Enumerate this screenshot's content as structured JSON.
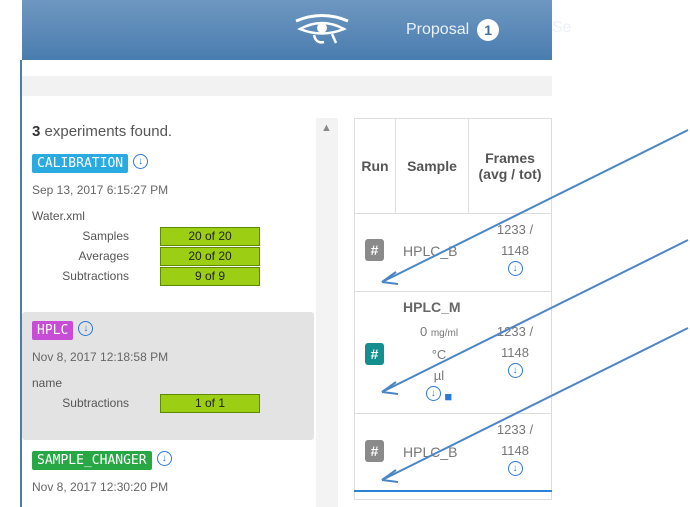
{
  "header": {
    "proposal_label": "Proposal",
    "proposal_count": "1",
    "next_tab_label": "Se"
  },
  "experiments": {
    "count": "3",
    "count_suffix": "experiments found.",
    "items": [
      {
        "tag": "CALIBRATION",
        "tag_color": "#29abe2",
        "date": "Sep 13, 2017 6:15:27 PM",
        "name": "Water.xml",
        "stats": [
          {
            "label": "Samples",
            "value": "20 of 20"
          },
          {
            "label": "Averages",
            "value": "20 of 20"
          },
          {
            "label": "Subtractions",
            "value": "9 of 9"
          }
        ]
      },
      {
        "tag": "HPLC",
        "tag_color": "#c74cd6",
        "date": "Nov 8, 2017 12:18:58 PM",
        "name": "name",
        "stats": [
          {
            "label": "Subtractions",
            "value": "1 of 1"
          }
        ]
      },
      {
        "tag": "SAMPLE_CHANGER",
        "tag_color": "#28a745",
        "date": "Nov 8, 2017 12:30:20 PM"
      }
    ]
  },
  "table": {
    "columns": [
      "Run",
      "Sample",
      "Frames",
      "(avg / tot)"
    ],
    "rows": [
      {
        "run": "#",
        "run_color": "#8a8a8a",
        "sample": "HPLC_B",
        "frames_avg": "1233 /",
        "frames_tot": "1148"
      },
      {
        "run": "#",
        "run_color": "#138f8f",
        "sample": "HPLC_M",
        "conc_value": "0",
        "conc_unit": "mg/ml",
        "temp_unit": "°C",
        "vol_unit": "µl",
        "frames_avg": "1233 /",
        "frames_tot": "1148"
      },
      {
        "run": "#",
        "run_color": "#8a8a8a",
        "sample": "HPLC_B",
        "frames_avg": "1233 /",
        "frames_tot": "1148"
      }
    ]
  },
  "colors": {
    "header_bg": "#4a7db0",
    "stat_green": "#9ccf14",
    "arrow": "#4a86c6",
    "download_blue": "#2979d6"
  }
}
